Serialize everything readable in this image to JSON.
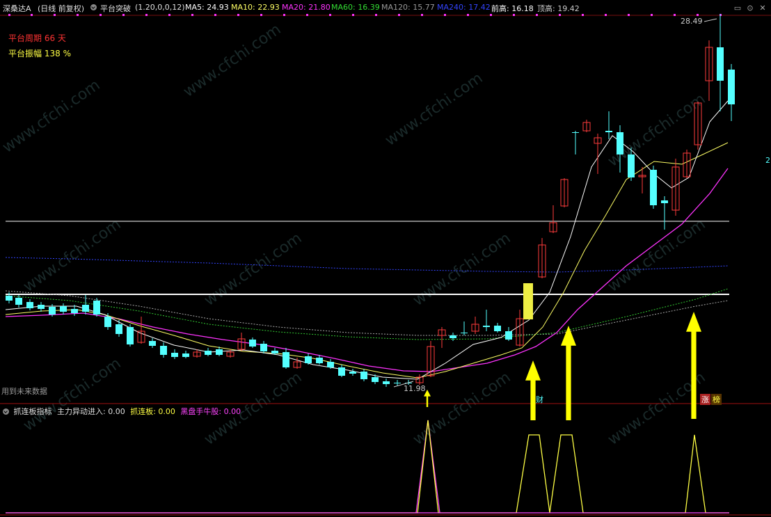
{
  "header": {
    "app_name": "深桑达A",
    "period_mode": "(日线 前复权)",
    "indicator_name": "平台突破",
    "indicator_params": "(1.20,0,0,12)",
    "ma5": "MA5: 24.93",
    "ma10": "MA10: 22.93",
    "ma20": "MA20: 21.80",
    "ma60": "MA60: 16.39",
    "ma120": "MA120: 15.77",
    "ma240": "MA240: 17.42",
    "prev_high": "前高: 16.18",
    "top_high": "顶高: 19.42"
  },
  "platform": {
    "period_label": "平台周期",
    "period_value": "66 天",
    "amp_label": "平台振幅",
    "amp_value": "138 %"
  },
  "labels": {
    "high_price": "28.49",
    "low_price": "11.98",
    "future_data": "用到未来数据",
    "badge_cai": "财",
    "badge_zhang": "涨",
    "badge_bang": "榜",
    "right_edge_mark": "2"
  },
  "sub_header": {
    "indicator_name": "抓连板指标",
    "main_abnormal": "主力异动进入: 0.00",
    "zhua_lianban": "抓连板: 0.00",
    "black_horse": "黑盘手牛股: 0.00"
  },
  "watermark": "www.cfchi.com",
  "colors": {
    "up": "#ff3b3b",
    "down": "#54ffff",
    "ma5": "#ffffff",
    "ma10": "#ffff66",
    "ma20": "#ff33ff",
    "ma60": "#33cc33",
    "ma120": "#999999",
    "ma240": "#3344ff",
    "arrow": "#ffff00",
    "signal": "#ffff44",
    "signal2": "#ff44ff"
  },
  "icons": [
    "dropdown-circle-icon",
    "settings-circle-icon",
    "minimize-icon",
    "restore-icon",
    "close-icon"
  ]
}
